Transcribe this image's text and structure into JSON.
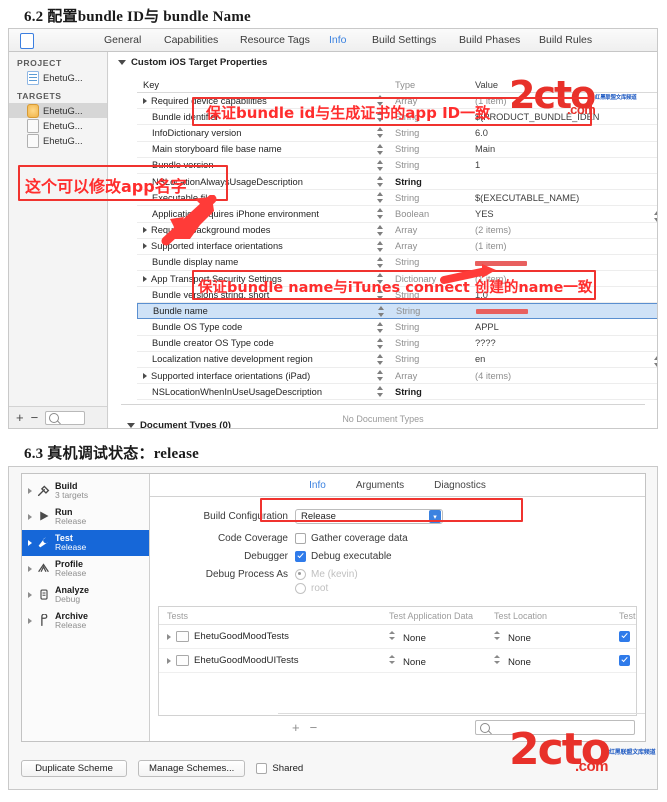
{
  "headings": {
    "sec62": "6.2 配置bundle ID与 bundle Name",
    "sec63": "6.3 真机调试状态：release"
  },
  "info_editor": {
    "tabs": [
      {
        "label": "General",
        "selected": false
      },
      {
        "label": "Capabilities",
        "selected": false
      },
      {
        "label": "Resource Tags",
        "selected": false
      },
      {
        "label": "Info",
        "selected": true
      },
      {
        "label": "Build Settings",
        "selected": false
      },
      {
        "label": "Build Phases",
        "selected": false
      },
      {
        "label": "Build Rules",
        "selected": false
      }
    ],
    "navigator": {
      "project_group": "PROJECT",
      "project_items": [
        {
          "label": "EhetuG...",
          "icon": "project-icon"
        }
      ],
      "targets_group": "TARGETS",
      "target_items": [
        {
          "label": "EhetuG...",
          "icon": "app-target-icon",
          "selected": true
        },
        {
          "label": "EhetuG...",
          "icon": "test-target-icon",
          "selected": false
        },
        {
          "label": "EhetuG...",
          "icon": "test-target-icon",
          "selected": false
        }
      ],
      "add_label": "+",
      "remove_label": "−",
      "search_icon": "search-icon"
    },
    "section_title": "Custom iOS Target Properties",
    "columns": {
      "key": "Key",
      "type": "Type",
      "value": "Value"
    },
    "rows": [
      {
        "key": "Required device capabilities",
        "type": "Array",
        "value": "(1 item)",
        "expandable": true,
        "grey_type": true,
        "grey_value": true,
        "selected": false
      },
      {
        "key": "Bundle identifier",
        "type": "String",
        "value": "$(PRODUCT_BUNDLE_IDEN",
        "expandable": false,
        "grey_type": true,
        "grey_value": false,
        "selected": false
      },
      {
        "key": "InfoDictionary version",
        "type": "String",
        "value": "6.0",
        "expandable": false,
        "grey_type": true,
        "grey_value": false,
        "selected": false
      },
      {
        "key": "Main storyboard file base name",
        "type": "String",
        "value": "Main",
        "expandable": false,
        "grey_type": true,
        "grey_value": false,
        "selected": false
      },
      {
        "key": "Bundle version",
        "type": "String",
        "value": "1",
        "expandable": false,
        "grey_type": true,
        "grey_value": false,
        "selected": false
      },
      {
        "key": "NSLocationAlwaysUsageDescription",
        "type": "String",
        "value": "",
        "expandable": false,
        "grey_type": false,
        "grey_value": false,
        "selected": false
      },
      {
        "key": "Executable file",
        "type": "String",
        "value": "$(EXECUTABLE_NAME)",
        "expandable": false,
        "grey_type": true,
        "grey_value": false,
        "selected": false
      },
      {
        "key": "Application requires iPhone environment",
        "type": "Boolean",
        "value": "YES",
        "expandable": false,
        "grey_type": true,
        "grey_value": false,
        "selected": false,
        "value_stepper": true
      },
      {
        "key": "Required background modes",
        "type": "Array",
        "value": "(2 items)",
        "expandable": true,
        "grey_type": true,
        "grey_value": true,
        "selected": false
      },
      {
        "key": "Supported interface orientations",
        "type": "Array",
        "value": "(1 item)",
        "expandable": true,
        "grey_type": true,
        "grey_value": true,
        "selected": false
      },
      {
        "key": "Bundle display name",
        "type": "String",
        "value": "",
        "expandable": false,
        "grey_type": true,
        "grey_value": false,
        "selected": false,
        "redacted_value": true
      },
      {
        "key": "App Transport Security Settings",
        "type": "Dictionary",
        "value": "(1 item)",
        "expandable": true,
        "grey_type": true,
        "grey_value": true,
        "selected": false
      },
      {
        "key": "Bundle versions string, short",
        "type": "String",
        "value": "1.0",
        "expandable": false,
        "grey_type": true,
        "grey_value": false,
        "selected": false
      },
      {
        "key": "Bundle name",
        "type": "String",
        "value": "",
        "expandable": false,
        "grey_type": true,
        "grey_value": false,
        "selected": true,
        "redacted_value": true
      },
      {
        "key": "Bundle OS Type code",
        "type": "String",
        "value": "APPL",
        "expandable": false,
        "grey_type": true,
        "grey_value": false,
        "selected": false
      },
      {
        "key": "Bundle creator OS Type code",
        "type": "String",
        "value": "????",
        "expandable": false,
        "grey_type": true,
        "grey_value": false,
        "selected": false
      },
      {
        "key": "Localization native development region",
        "type": "String",
        "value": "en",
        "expandable": false,
        "grey_type": true,
        "grey_value": false,
        "selected": false,
        "value_stepper": true
      },
      {
        "key": "Supported interface orientations (iPad)",
        "type": "Array",
        "value": "(4 items)",
        "expandable": true,
        "grey_type": true,
        "grey_value": true,
        "selected": false
      },
      {
        "key": "NSLocationWhenInUseUsageDescription",
        "type": "String",
        "value": "",
        "expandable": false,
        "grey_type": false,
        "grey_value": false,
        "selected": false
      }
    ],
    "document_types": "Document Types (0)",
    "no_document_types": "No Document Types"
  },
  "annotations": [
    {
      "id": "ann-bundle-id",
      "text": "保证bundle id与生成证书的app ID一致"
    },
    {
      "id": "ann-app-name",
      "text": "这个可以修改app名字"
    },
    {
      "id": "ann-bundle-name",
      "text": "保证bundle name与iTunes connect 创建的name一致"
    }
  ],
  "scheme_editor": {
    "actions": [
      {
        "name": "Build",
        "sub": "3 targets",
        "icon": "hammer-icon",
        "glyph": "⚒",
        "selected": false
      },
      {
        "name": "Run",
        "sub": "Release",
        "icon": "play-icon",
        "glyph": "▶",
        "selected": false
      },
      {
        "name": "Test",
        "sub": "Release",
        "icon": "wrench-icon",
        "glyph": "ὒ7",
        "selected": true
      },
      {
        "name": "Profile",
        "sub": "Release",
        "icon": "gauge-icon",
        "glyph": "⏱",
        "selected": false
      },
      {
        "name": "Analyze",
        "sub": "Debug",
        "icon": "stethoscope-icon",
        "glyph": "⚇",
        "selected": false
      },
      {
        "name": "Archive",
        "sub": "Release",
        "icon": "box-icon",
        "glyph": "⧉",
        "selected": false
      }
    ],
    "tabs": [
      {
        "label": "Info",
        "selected": true
      },
      {
        "label": "Arguments",
        "selected": false
      },
      {
        "label": "Diagnostics",
        "selected": false
      }
    ],
    "fields": {
      "build_configuration_label": "Build Configuration",
      "build_configuration_value": "Release",
      "code_coverage_label": "Code Coverage",
      "code_coverage_option": "Gather coverage data",
      "code_coverage_checked": false,
      "debugger_label": "Debugger",
      "debugger_option": "Debug executable",
      "debugger_checked": true,
      "debug_process_label": "Debug Process As",
      "debug_process_options": [
        {
          "label": "Me (kevin)",
          "selected": true
        },
        {
          "label": "root",
          "selected": false
        }
      ]
    },
    "tests_table": {
      "columns": [
        "Tests",
        "Test Application Data",
        "Test Location",
        "Test"
      ],
      "rows": [
        {
          "name": "EhetuGoodMoodTests",
          "data": "None",
          "location": "None",
          "enabled": true
        },
        {
          "name": "EhetuGoodMoodUITests",
          "data": "None",
          "location": "None",
          "enabled": true
        }
      ]
    },
    "footer": {
      "add_label": "+",
      "remove_label": "−",
      "search_icon": "search-icon"
    },
    "buttons": {
      "duplicate": "Duplicate Scheme",
      "manage": "Manage Schemes...",
      "shared_label": "Shared",
      "shared_checked": false
    }
  },
  "watermark": {
    "brand": "2cto",
    "domain": ".com",
    "cn": "红黑联盟文库频道"
  },
  "colors": {
    "accent_blue": "#3b82e0",
    "selection_blue": "#1667d8",
    "annotation_red": "#ff2d2d",
    "watermark_red": "#e8312a"
  }
}
